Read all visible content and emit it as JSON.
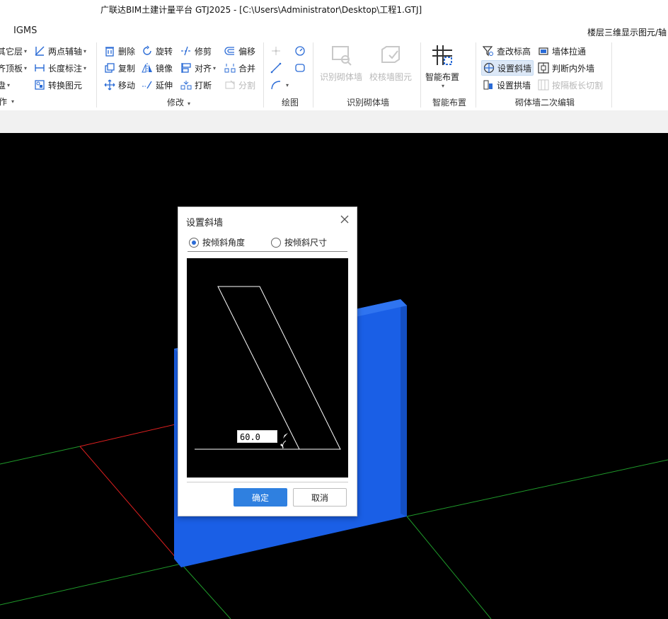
{
  "window": {
    "title": "广联达BIM土建计量平台 GTJ2025 - [C:\\Users\\Administrator\\Desktop\\工程1.GTJ]"
  },
  "menubar": {
    "left_item": "IGMS",
    "right_item": "楼层三维显示图元/轴"
  },
  "ribbon": {
    "col0": [
      "其它层",
      "齐顶板",
      "盘",
      "作"
    ],
    "col1": [
      "两点辅轴",
      "长度标注",
      "转换图元"
    ],
    "modify_col1": [
      "删除",
      "复制",
      "移动"
    ],
    "modify_col2": [
      "旋转",
      "镜像",
      "延伸"
    ],
    "modify_col3": [
      "修剪",
      "对齐",
      "打断"
    ],
    "modify_col4": [
      "偏移",
      "合并",
      "分割"
    ],
    "groups": {
      "modify": "修改",
      "draw": "绘图",
      "identify": "识别砌体墙",
      "smart": "智能布置",
      "masonry_edit": "砌体墙二次编辑"
    },
    "identify_buttons": [
      "识别砌体墙",
      "校核墙图元"
    ],
    "smart_button": "智能布置",
    "masonry_col1": [
      "查改标高",
      "设置斜墙",
      "设置拱墙"
    ],
    "masonry_col2": [
      "墙体拉通",
      "判断内外墙",
      "按隔板长切割"
    ]
  },
  "dialog": {
    "title": "设置斜墙",
    "radio_angle": "按倾斜角度",
    "radio_size": "按倾斜尺寸",
    "selected": "angle",
    "angle_value": "60.0",
    "ok_label": "确定",
    "cancel_label": "取消"
  },
  "colors": {
    "accent": "#2f80e0",
    "wall": "#1a5fe6",
    "axis_red": "#e02020",
    "axis_green": "#1f9a2a"
  }
}
